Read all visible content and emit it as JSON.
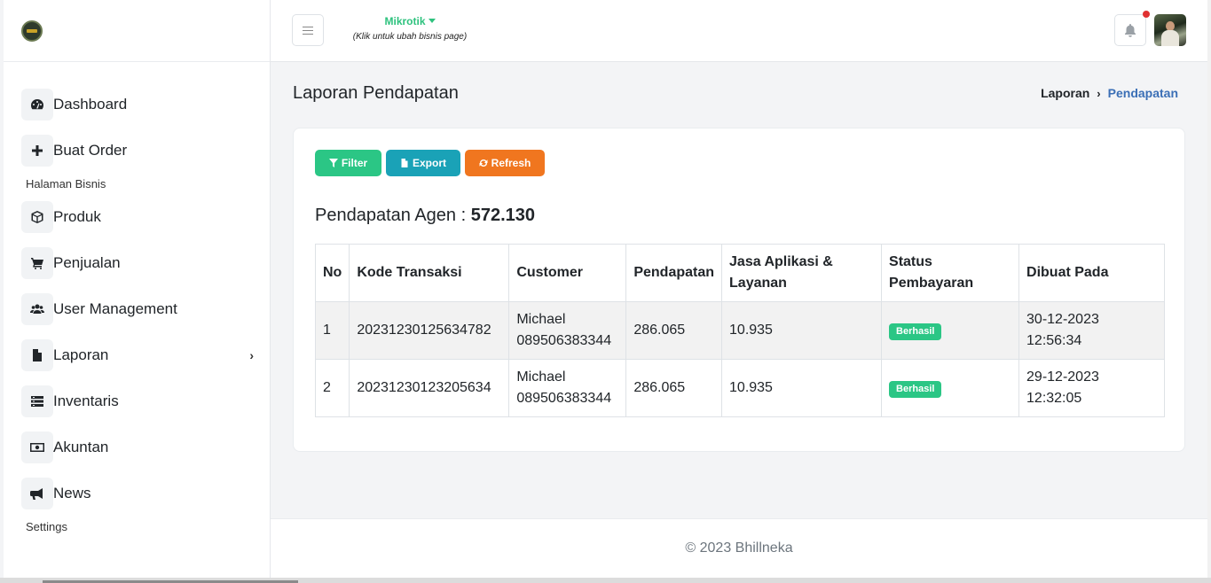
{
  "sidebar": {
    "menu": [
      {
        "label": "Dashboard",
        "icon": "dashboard-icon"
      },
      {
        "label": "Buat Order",
        "icon": "plus-icon"
      }
    ],
    "section_business": "Halaman Bisnis",
    "business_menu": [
      {
        "label": "Produk",
        "icon": "box-icon"
      },
      {
        "label": "Penjualan",
        "icon": "cart-icon"
      },
      {
        "label": "User Management",
        "icon": "users-icon"
      },
      {
        "label": "Laporan",
        "icon": "file-icon",
        "chevron": "›"
      },
      {
        "label": "Inventaris",
        "icon": "inventory-icon"
      },
      {
        "label": "Akuntan",
        "icon": "money-icon"
      },
      {
        "label": "News",
        "icon": "megaphone-icon"
      }
    ],
    "section_settings": "Settings"
  },
  "topbar": {
    "business_name": "Mikrotik",
    "business_hint": "(Klik untuk ubah bisnis page)"
  },
  "page": {
    "title": "Laporan Pendapatan",
    "breadcrumb": [
      "Laporan",
      "Pendapatan"
    ],
    "buttons": {
      "filter": "Filter",
      "export": "Export",
      "refresh": "Refresh"
    },
    "total_label": "Pendapatan Agen : ",
    "total_value": "572.130"
  },
  "table": {
    "headers": [
      "No",
      "Kode Transaksi",
      "Customer",
      "Pendapatan",
      "Jasa Aplikasi & Layanan",
      "Status Pembayaran",
      "Dibuat Pada"
    ],
    "rows": [
      {
        "no": "1",
        "kode": "20231230125634782",
        "customer_name": "Michael",
        "customer_phone": "089506383344",
        "pendapatan": "286.065",
        "jasa": "10.935",
        "status": "Berhasil",
        "date": "30-12-2023",
        "time": "12:56:34"
      },
      {
        "no": "2",
        "kode": "20231230123205634",
        "customer_name": "Michael",
        "customer_phone": "089506383344",
        "pendapatan": "286.065",
        "jasa": "10.935",
        "status": "Berhasil",
        "date": "29-12-2023",
        "time": "12:32:05"
      }
    ]
  },
  "footer": {
    "text": "© 2023 Bhillneka"
  },
  "colors": {
    "success": "#2bc685",
    "info": "#1aa2b7",
    "warning": "#f0761f",
    "link": "#3b6fb6"
  }
}
